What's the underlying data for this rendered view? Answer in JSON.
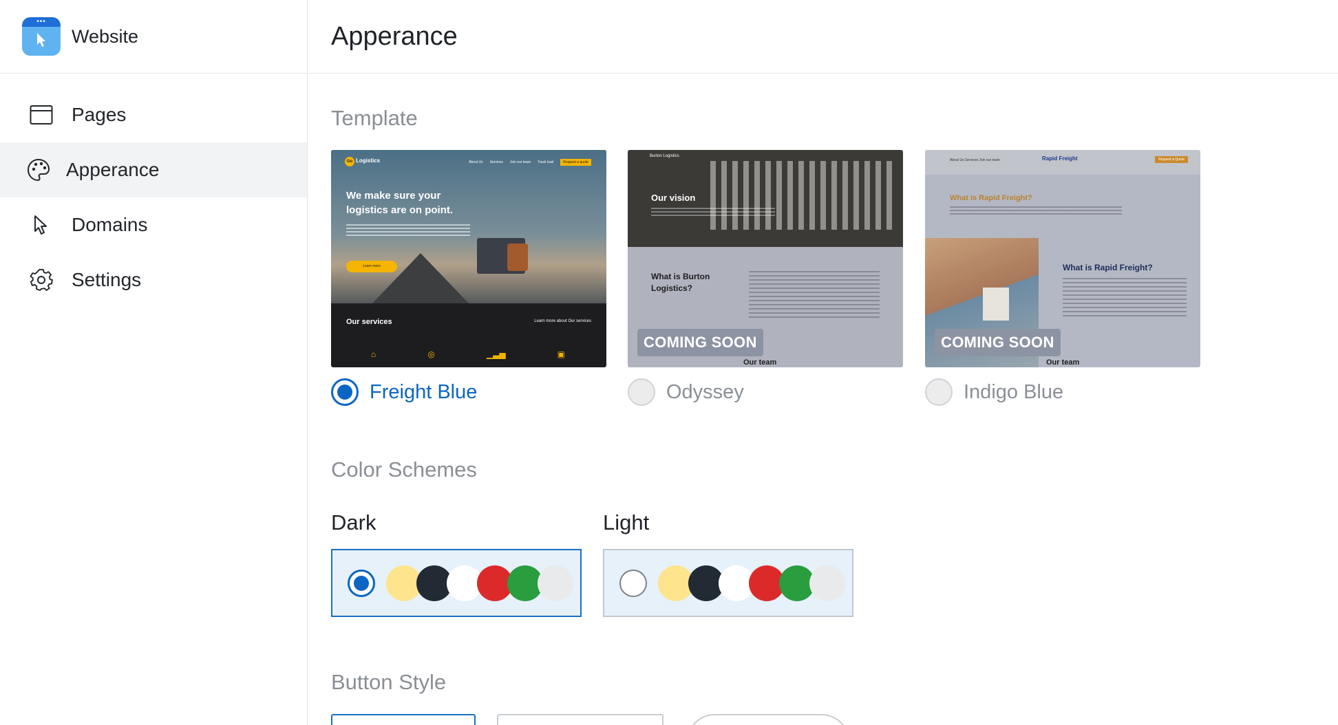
{
  "app": {
    "name": "Website",
    "logo_icon": "cursor-window-icon",
    "logo_dots": "•••"
  },
  "sidebar": {
    "items": [
      {
        "label": "Pages",
        "icon": "window-icon",
        "active": false
      },
      {
        "label": "Apperance",
        "icon": "palette-icon",
        "active": true
      },
      {
        "label": "Domains",
        "icon": "cursor-icon",
        "active": false
      },
      {
        "label": "Settings",
        "icon": "gear-icon",
        "active": false
      }
    ]
  },
  "header": {
    "title": "Apperance"
  },
  "template_section": {
    "title": "Template",
    "templates": [
      {
        "name": "Freight Blue",
        "selected": true,
        "coming_soon": false,
        "preview": {
          "logo_badge": "Go",
          "logo": "Logistics",
          "menu": [
            "About Us",
            "Services",
            "Join our team",
            "Track load"
          ],
          "menu_cta": "Request a quote",
          "headline": "We make sure your logistics are on point.",
          "button": "Learn more",
          "services": "Our services",
          "more": "Learn more about Our services"
        }
      },
      {
        "name": "Odyssey",
        "selected": false,
        "coming_soon": true,
        "coming_soon_label": "COMING SOON",
        "preview": {
          "brand": "Burton Logistics",
          "vision": "Our vision",
          "heading": "What is Burton Logistics?",
          "team": "Our team"
        }
      },
      {
        "name": "Indigo Blue",
        "selected": false,
        "coming_soon": true,
        "coming_soon_label": "COMING SOON",
        "preview": {
          "brand": "Rapid Freight",
          "menu": "About Us   Services   Join our team",
          "cta": "Request a Quote",
          "heading_1": "What is Rapid Freight?",
          "heading_2": "What is Rapid Freight?",
          "team": "Our team"
        }
      }
    ]
  },
  "color_schemes": {
    "title": "Color Schemes",
    "schemes": [
      {
        "name": "Dark",
        "selected": true,
        "swatches": [
          "#fde48d",
          "#222a33",
          "#ffffff",
          "#dc2a2a",
          "#2a9d3e",
          "#e9eaeb"
        ]
      },
      {
        "name": "Light",
        "selected": false,
        "swatches": [
          "#fde48d",
          "#222a33",
          "#ffffff",
          "#dc2a2a",
          "#2a9d3e",
          "#e9eaeb"
        ]
      }
    ]
  },
  "button_style": {
    "title": "Button Style"
  },
  "colors": {
    "accent": "#0a66c2",
    "muted_text": "#8a8f96",
    "active_nav_bg": "#f2f3f4",
    "scheme_bg": "#e6f1fa"
  }
}
